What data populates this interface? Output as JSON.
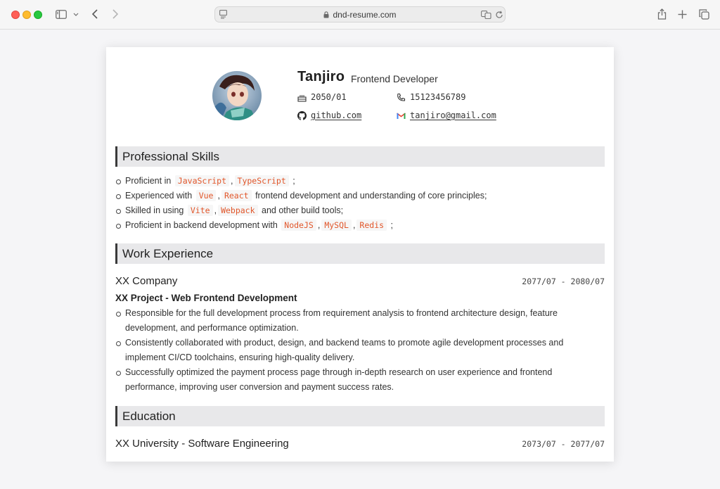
{
  "browser": {
    "url": "dnd-resume.com"
  },
  "resume": {
    "name": "Tanjiro",
    "role": "Frontend Developer",
    "birth": "2050/01",
    "phone": "15123456789",
    "github": "github.com",
    "email": "tanjiro@gmail.com",
    "skills_title": "Professional Skills",
    "skills": [
      {
        "pre": "Proficient in",
        "tags": [
          "JavaScript",
          "TypeScript"
        ],
        "post": ";"
      },
      {
        "pre": "Experienced with",
        "tags": [
          "Vue",
          "React"
        ],
        "post": "frontend development and understanding of core principles;"
      },
      {
        "pre": "Skilled in using",
        "tags": [
          "Vite",
          "Webpack"
        ],
        "post": "and other build tools;"
      },
      {
        "pre": "Proficient in backend development with",
        "tags": [
          "NodeJS",
          "MySQL",
          "Redis"
        ],
        "post": ";"
      }
    ],
    "work_title": "Work Experience",
    "work": {
      "company": "XX Company",
      "date": "2077/07 - 2080/07",
      "project": "XX Project - Web Frontend Development",
      "bullets": [
        "Responsible for the full development process from requirement analysis to frontend architecture design, feature development, and performance optimization.",
        "Consistently collaborated with product, design, and backend teams to promote agile development processes and implement CI/CD toolchains, ensuring high-quality delivery.",
        "Successfully optimized the payment process page through in-depth research on user experience and frontend performance, improving user conversion and payment success rates."
      ]
    },
    "edu_title": "Education",
    "edu": {
      "school": "XX University - Software Engineering",
      "date": "2073/07 - 2077/07"
    }
  }
}
